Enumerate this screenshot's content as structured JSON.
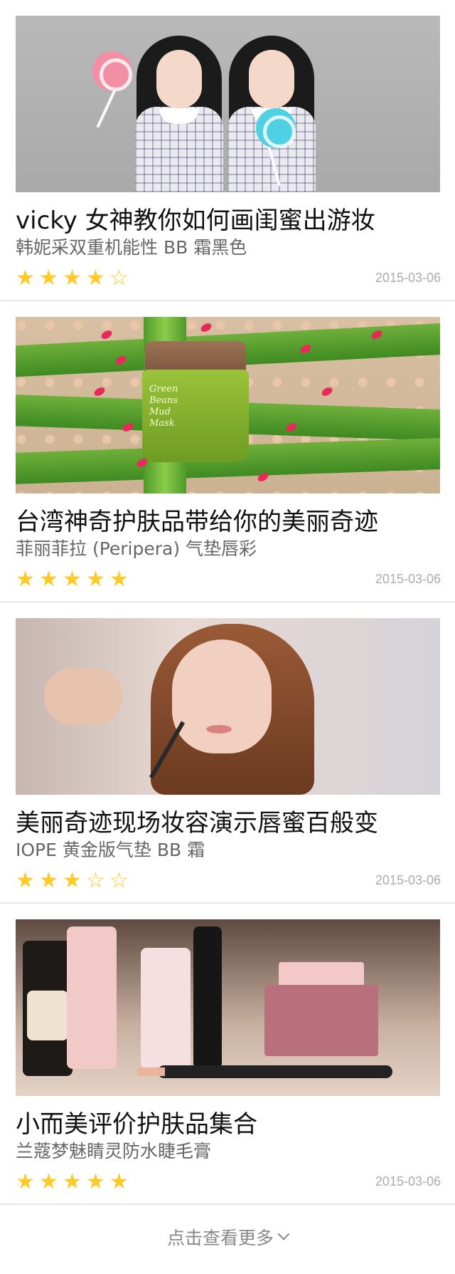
{
  "articles": [
    {
      "title": "vicky 女神教你如何画闺蜜出游妆",
      "subtitle": "韩妮采双重机能性 BB 霜黑色",
      "rating": 4,
      "date": "2015-03-06",
      "image_icon": "portrait-image"
    },
    {
      "title": "台湾神奇护肤品带给你的美丽奇迹",
      "subtitle": "菲丽菲拉 (Peripera) 气垫唇彩",
      "rating": 5,
      "date": "2015-03-06",
      "image_icon": "product-image",
      "image_text": [
        "Green",
        "Beans",
        "Mud",
        "Mask"
      ]
    },
    {
      "title": "美丽奇迹现场妆容演示唇蜜百般变",
      "subtitle": "IOPE 黄金版气垫 BB 霜",
      "rating": 3,
      "date": "2015-03-06",
      "image_icon": "makeup-demo-image"
    },
    {
      "title": "小而美评价护肤品集合",
      "subtitle": "兰蔻梦魅睛灵防水睫毛膏",
      "rating": 5,
      "date": "2015-03-06",
      "image_icon": "cosmetics-collection-image"
    }
  ],
  "load_more": {
    "label": "点击查看更多",
    "icon": "chevron-down-icon"
  },
  "colors": {
    "star": "#ffc928",
    "divider": "#e7e7e7",
    "subtitle": "#666666",
    "date": "#aaaaaa"
  }
}
